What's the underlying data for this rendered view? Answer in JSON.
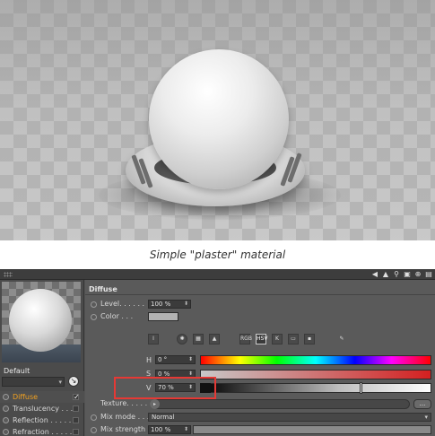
{
  "caption": "Simple \"plaster\" material",
  "preview": {
    "material_name": "Default"
  },
  "channels": [
    {
      "label": "Diffuse",
      "active": true,
      "checked": true
    },
    {
      "label": "Translucency . . . .",
      "active": false,
      "checked": false
    },
    {
      "label": "Reflection . . . . .",
      "active": false,
      "checked": false
    },
    {
      "label": "Refraction . . . . .",
      "active": false,
      "checked": false
    }
  ],
  "panel": {
    "section_title": "Diffuse",
    "level": {
      "label": "Level. . . . . .",
      "value": "100 %"
    },
    "color": {
      "label": "Color . . .",
      "swatch": "#b3b3b3"
    },
    "tools": [
      "RGB",
      "HSV",
      "K"
    ],
    "h": {
      "label": "H",
      "value": "0 °"
    },
    "s": {
      "label": "S",
      "value": "0 %"
    },
    "v": {
      "label": "V",
      "value": "70 %"
    },
    "texture": {
      "label": "Texture. . . . .",
      "button": "..."
    },
    "mix_mode": {
      "label": "Mix mode . . .",
      "value": "Normal"
    },
    "mix_strength": {
      "label": "Mix strength",
      "value": "100 %"
    }
  },
  "colors": {
    "highlight": "#e53935",
    "active_channel": "#f0a020"
  }
}
